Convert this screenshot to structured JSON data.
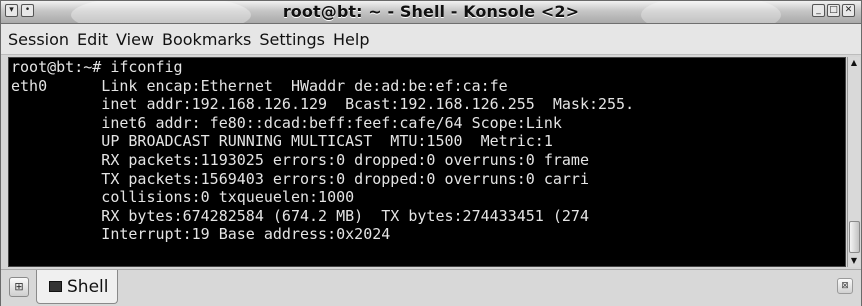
{
  "window": {
    "title": "root@bt: ~ - Shell - Konsole <2>"
  },
  "menu": [
    "Session",
    "Edit",
    "View",
    "Bookmarks",
    "Settings",
    "Help"
  ],
  "terminal": {
    "lines": [
      "root@bt:~# ifconfig",
      "eth0      Link encap:Ethernet  HWaddr de:ad:be:ef:ca:fe",
      "          inet addr:192.168.126.129  Bcast:192.168.126.255  Mask:255.",
      "          inet6 addr: fe80::dcad:beff:feef:cafe/64 Scope:Link",
      "          UP BROADCAST RUNNING MULTICAST  MTU:1500  Metric:1",
      "          RX packets:1193025 errors:0 dropped:0 overruns:0 frame",
      "          TX packets:1569403 errors:0 dropped:0 overruns:0 carri",
      "          collisions:0 txqueuelen:1000",
      "          RX bytes:674282584 (674.2 MB)  TX bytes:274433451 (274",
      "          Interrupt:19 Base address:0x2024"
    ]
  },
  "tabs": [
    {
      "label": "Shell",
      "icon": "terminal-icon"
    }
  ],
  "icons": {
    "new_tab": "new-tab-icon",
    "close_tab": "close-tab-icon",
    "scroll_up": "arrow-up-icon",
    "scroll_down": "arrow-down-icon"
  }
}
